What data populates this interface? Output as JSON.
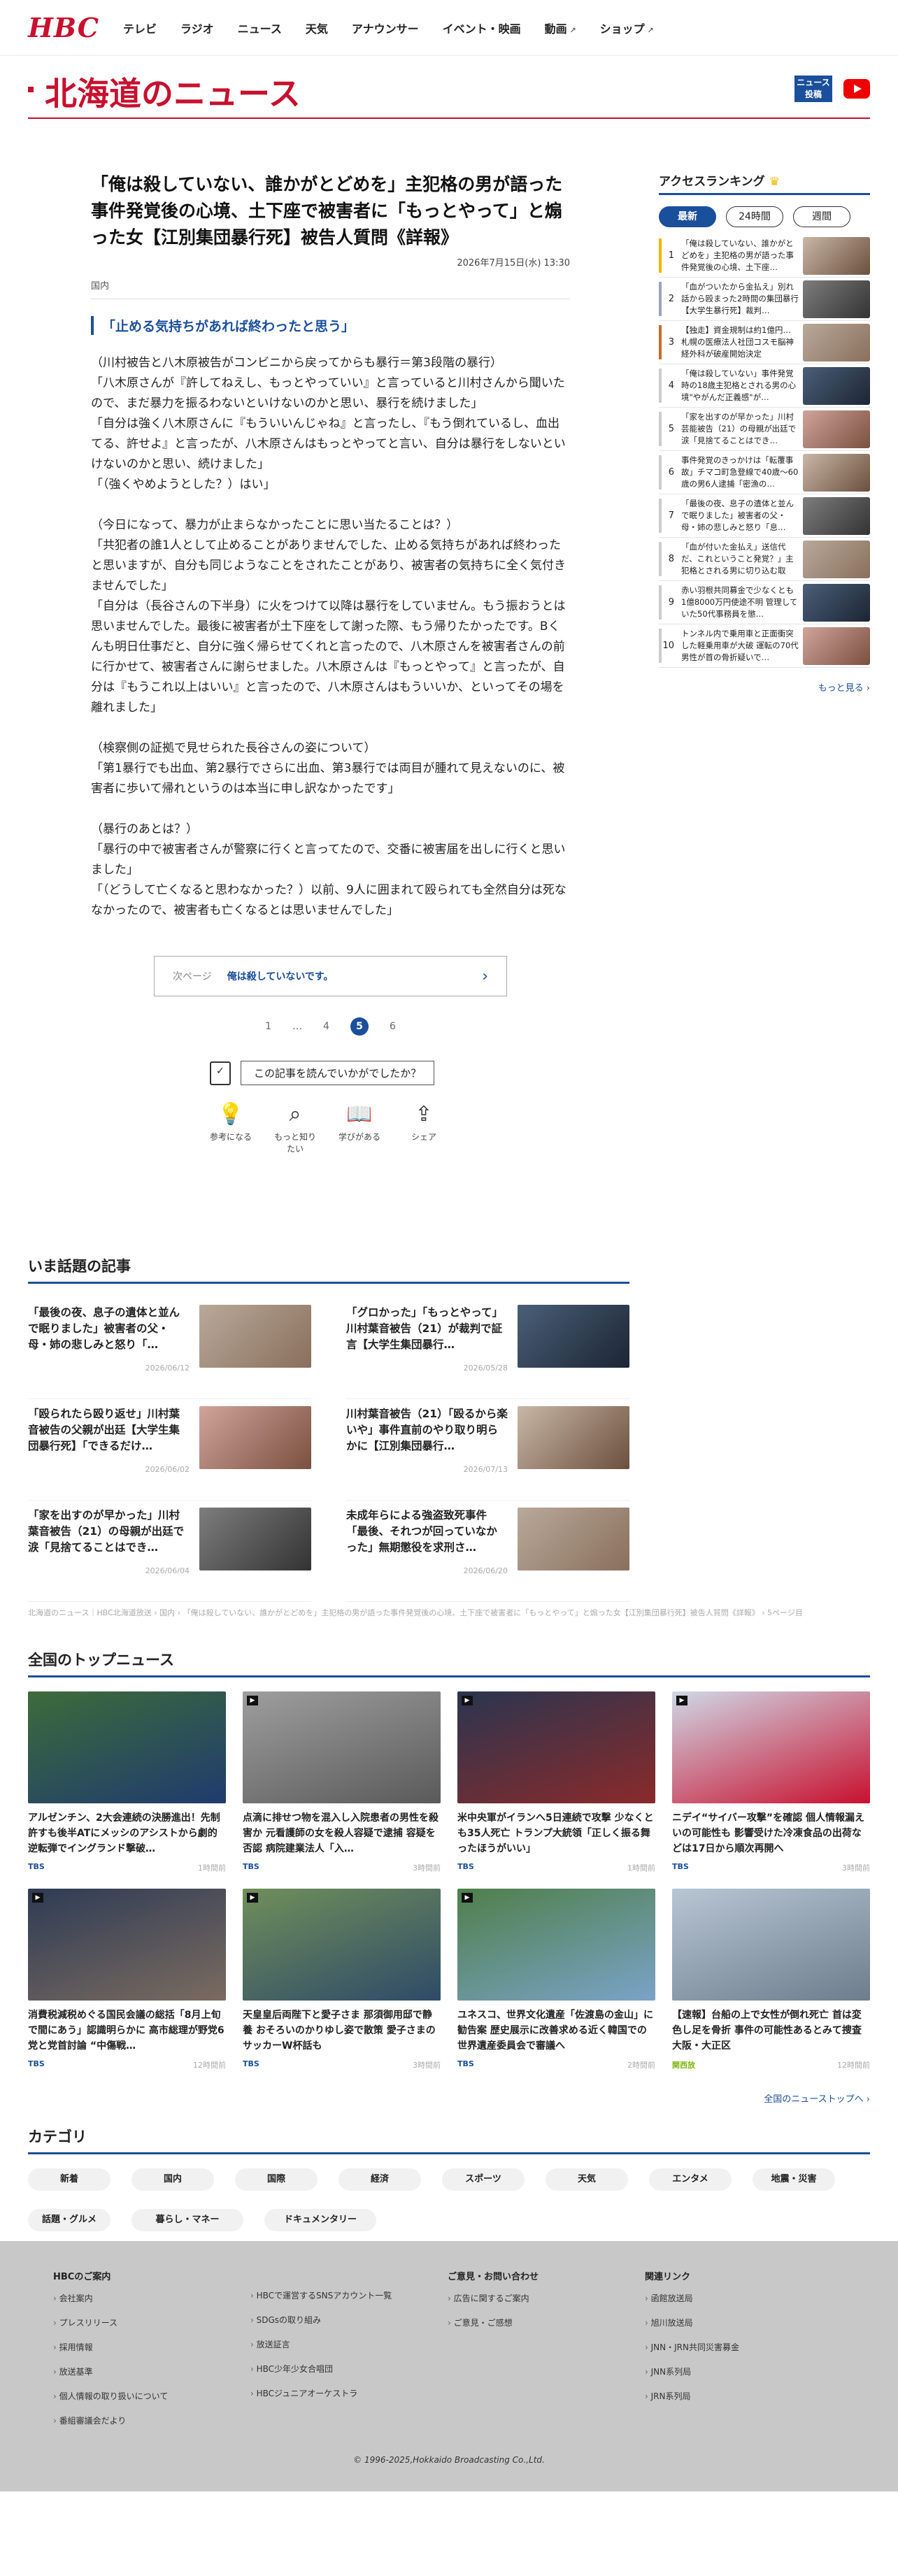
{
  "header": {
    "logo": "HBC",
    "nav": [
      "テレビ",
      "ラジオ",
      "ニュース",
      "天気",
      "アナウンサー",
      "イベント・映画",
      "動画",
      "ショップ"
    ]
  },
  "site": {
    "title": "北海道のニュース",
    "newspost_label": "ニュース投稿"
  },
  "article": {
    "title": "「俺は殺していない、誰かがとどめを」主犯格の男が語った事件発覚後の心境、土下座で被害者に「もっとやって」と煽った女【江別集団暴行死】被告人質問《詳報》",
    "date": "2026年7月15日(水) 13:30",
    "category": "国内",
    "subheading": "「止める気持ちがあれば終わったと思う」",
    "paragraphs": [
      "（川村被告と八木原被告がコンビニから戻ってからも暴行＝第3段階の暴行）",
      "「八木原さんが『許してねえし、もっとやっていい』と言っていると川村さんから聞いたので、まだ暴力を振るわないといけないのかと思い、暴行を続けました」",
      "「自分は強く八木原さんに『もういいんじゃね』と言ったし、『もう倒れているし、血出てる、許せよ』と言ったが、八木原さんはもっとやってと言い、自分は暴行をしないといけないのかと思い、続けました」",
      "「（強くやめようとした？）はい」",
      "",
      "（今日になって、暴力が止まらなかったことに思い当たることは？）",
      "「共犯者の誰1人として止めることがありませんでした、止める気持ちがあれば終わったと思いますが、自分も同じようなことをされたことがあり、被害者の気持ちに全く気付きませんでした」",
      "「自分は（長谷さんの下半身）に火をつけて以降は暴行をしていません。もう振おうとは思いませんでした。最後に被害者が土下座をして謝った際、もう帰りたかったです。Bくんも明日仕事だと、自分に強く帰らせてくれと言ったので、八木原さんを被害者さんの前に行かせて、被害者さんに謝らせました。八木原さんは『もっとやって』と言ったが、自分は『もうこれ以上はいい』と言ったので、八木原さんはもういいか、といってその場を離れました」",
      "",
      "（検察側の証拠で見せられた長谷さんの姿について）",
      "「第1暴行でも出血、第2暴行でさらに出血、第3暴行では両目が腫れて見えないのに、被害者に歩いて帰れというのは本当に申し訳なかったです」",
      "",
      "（暴行のあとは？）",
      "「暴行の中で被害者さんが警察に行くと言ってたので、交番に被害届を出しに行くと思いました」",
      "「（どうして亡くなると思わなかった？）以前、9人に囲まれて殴られても全然自分は死ななかったので、被害者も亡くなるとは思いませんでした」"
    ],
    "next_label": "次ページ",
    "next_title": "俺は殺していないです。",
    "pages": [
      "1",
      "…",
      "4",
      "5",
      "6"
    ],
    "current_page": "5",
    "feedback_q": "この記事を読んでいかがでしたか？",
    "feedback": [
      {
        "label": "参考になる",
        "icon": "lightbulb-icon"
      },
      {
        "label": "もっと知りたい",
        "icon": "magnifier-icon"
      },
      {
        "label": "学びがある",
        "icon": "book-icon"
      },
      {
        "label": "シェア",
        "icon": "share-icon"
      }
    ]
  },
  "ranking": {
    "title": "アクセスランキング",
    "tabs": [
      "最新",
      "24時間",
      "週間"
    ],
    "items": [
      {
        "n": "1",
        "text": "「俺は殺していない、誰かがとどめを」主犯格の男が語った事件発覚後の心境、土下座…",
        "color": "#f2b600"
      },
      {
        "n": "2",
        "text": "「血がついたから金払え」別れ話から殴まった2時間の集団暴行【大学生暴行死】裁判…",
        "color": "#9aa5b8"
      },
      {
        "n": "3",
        "text": "【独走】資金規制は約1億円…札幌の医療法人社団コスモ脳神経外科が破産開始決定",
        "color": "#c76a2a"
      },
      {
        "n": "4",
        "text": "「俺は殺していない」事件発覚時の18歳主犯格とされる男の心境\"やがんだ正義感\"が…",
        "color": "#ccc"
      },
      {
        "n": "5",
        "text": "「家を出すのが早かった」川村芸能被告（21）の母親が出廷で涙「見捨てることはでき…",
        "color": "#ccc"
      },
      {
        "n": "6",
        "text": "事件発覚のきっかけは「転覆事故」チマコ町急登線で40歳～60歳の男6人逮捕「密漁の…",
        "color": "#ccc"
      },
      {
        "n": "7",
        "text": "「最後の夜、息子の遺体と並んで眠りました」被害者の父・母・姉の悲しみと怒り「息…",
        "color": "#ccc"
      },
      {
        "n": "8",
        "text": "「血が付いた金払え」送信代だ、これということ発覚？」主犯格とされる男に切り込む取材…",
        "color": "#ccc"
      },
      {
        "n": "9",
        "text": "赤い羽根共同募金で少なくとも1億8000万円使途不明 管理していた50代事務員を懲…",
        "color": "#ccc"
      },
      {
        "n": "10",
        "text": "トンネル内で乗用車と正面衝突した軽乗用車が大破 運転の70代男性が首の骨折疑いで…",
        "color": "#ccc"
      }
    ],
    "more": "もっと見る"
  },
  "topics": {
    "title": "いま話題の記事",
    "items": [
      {
        "title": "「最後の夜、息子の遺体と並んで眠りました」被害者の父・母・姉の悲しみと怒り「…",
        "date": "2026/06/12"
      },
      {
        "title": "「グロかった」「もっとやって」川村葉音被告（21）が裁判で証言【大学生集団暴行…",
        "date": "2026/05/28"
      },
      {
        "title": "「殴られたら殴り返せ」川村葉音被告の父親が出廷【大学生集団暴行死】「できるだけ…",
        "date": "2026/06/02"
      },
      {
        "title": "川村葉音被告（21）「殴るから楽いや」事件直前のやり取り明らかに【江別集団暴行…",
        "date": "2026/07/13"
      },
      {
        "title": "「家を出すのが早かった」川村葉音被告（21）の母親が出廷で涙「見捨てることはでき…",
        "date": "2026/06/04"
      },
      {
        "title": "未成年らによる強盗致死事件「最後、それつが回っていなかった」無期懲役を求刑さ…",
        "date": "2026/06/20"
      }
    ]
  },
  "breadcrumb": [
    "北海道のニュース｜HBC北海道放送",
    "国内",
    "「俺は殺していない、誰かがとどめを」主犯格の男が語った事件発覚後の心境、土下座で被害者に「もっとやって」と煽った女【江別集団暴行死】被告人質問《詳報》",
    "5ページ目"
  ],
  "national": {
    "title": "全国のトップニュース",
    "items": [
      {
        "title": "アルゼンチン、2大会連続の決勝進出！先制許すも後半ATにメッシのアシストから劇的逆転弾でイングランド撃破…",
        "src": "TBS",
        "ago": "1時間前",
        "video": false
      },
      {
        "title": "点滴に排せつ物を混入し入院患者の男性を殺害か 元看護師の女を殺人容疑で逮捕 容疑を否認 病院建業法人「入…",
        "src": "TBS",
        "ago": "3時間前",
        "video": true
      },
      {
        "title": "米中央軍がイランへ5日連続で攻撃 少なくとも35人死亡 トランプ大統領「正しく振る舞ったほうがいい」",
        "src": "TBS",
        "ago": "1時間前",
        "video": true
      },
      {
        "title": "ニデイ“サイバー攻撃”を確認 個人情報漏えいの可能性も 影響受けた冷凍食品の出荷などは17日から順次再開へ",
        "src": "TBS",
        "ago": "3時間前",
        "video": true
      },
      {
        "title": "消費税減税めぐる国民会議の総括「8月上旬で間にあう」認識明らかに 高市総理が野党6党と党首討論 “中傷戦…",
        "src": "TBS",
        "ago": "12時間前",
        "video": true
      },
      {
        "title": "天皇皇后両陛下と愛子さま 那須御用邸で静養 おそろいのかりゆし姿で散策 愛子さまのサッカーW杯話も",
        "src": "TBS",
        "ago": "3時間前",
        "video": true
      },
      {
        "title": "ユネスコ、世界文化遺産「佐渡島の金山」に勧告案 歴史展示に改善求める近く韓国での世界遺産委員会で審議へ",
        "src": "TBS",
        "ago": "2時間前",
        "video": true
      },
      {
        "title": "【速報】台船の上で女性が倒れ死亡 首は変色し足を骨折 事件の可能性あるとみて捜査 大阪・大正区",
        "src": "関西放",
        "ago": "12時間前",
        "video": false
      }
    ],
    "more": "全国のニューストップへ"
  },
  "categories": {
    "title": "カテゴリ",
    "items": [
      "新着",
      "国内",
      "国際",
      "経済",
      "スポーツ",
      "天気",
      "エンタメ",
      "地震・災害",
      "話題・グルメ",
      "暮らし・マネー",
      "ドキュメンタリー"
    ]
  },
  "footer": {
    "col1_title": "HBCのご案内",
    "col1": [
      "会社案内",
      "プレスリリース",
      "採用情報",
      "放送基準",
      "個人情報の取り扱いについて",
      "番組審議会だより"
    ],
    "col2": [
      "HBCで運営するSNSアカウント一覧",
      "SDGsの取り組み",
      "放送証言",
      "HBC少年少女合唱団",
      "HBCジュニアオーケストラ"
    ],
    "col3_title": "ご意見・お問い合わせ",
    "col3": [
      "広告に関するご案内",
      "ご意見・ご感想"
    ],
    "col4_title": "関連リンク",
    "col4": [
      "函館放送局",
      "旭川放送局",
      "JNN・JRN共同災害募金",
      "JNN系列局",
      "JRN系列局"
    ],
    "copyright": "© 1996-2025,Hokkaido Broadcasting Co.,Ltd."
  },
  "colors": {
    "brand_red": "#c8102e",
    "accent_blue": "#1a4f9c"
  }
}
